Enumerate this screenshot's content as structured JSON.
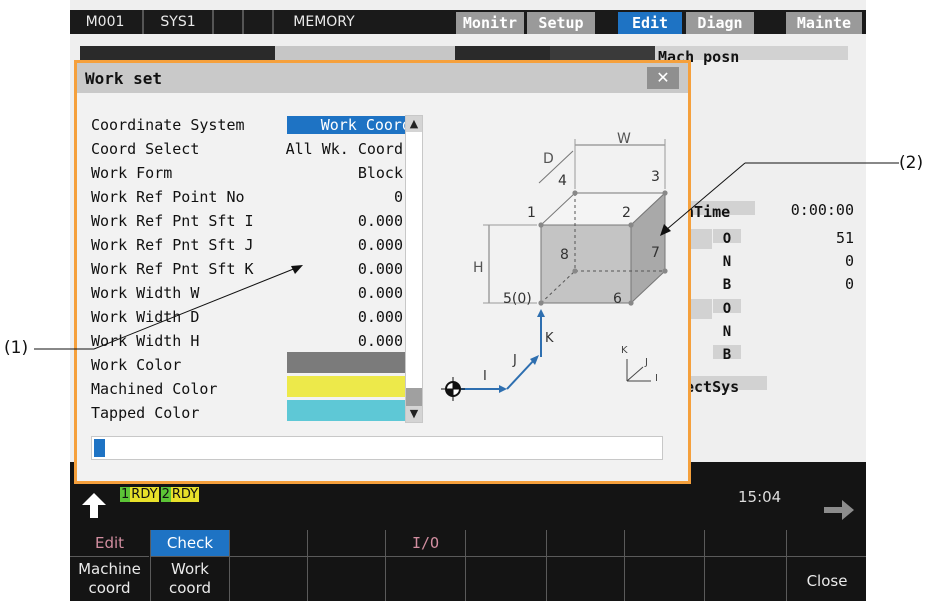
{
  "top_bar": {
    "machine": "M001",
    "system": "SYS1",
    "mode": "MEMORY",
    "menu_tabs": [
      "Monitr",
      "Setup",
      "Edit",
      "Diagn",
      "Mainte"
    ],
    "active_tab": "Edit"
  },
  "background_panel": {
    "mach_posn_label": "Mach posn",
    "time_label": "hTime",
    "time_value": "0:00:00",
    "rows_a": [
      {
        "key": "O",
        "value": "51"
      },
      {
        "key": "N",
        "value": "0"
      },
      {
        "key": "B",
        "value": "0"
      }
    ],
    "rows_b": [
      {
        "key": "O"
      },
      {
        "key": "N"
      },
      {
        "key": "B"
      }
    ],
    "select_label": "ectSys"
  },
  "dialog": {
    "title": "Work set",
    "close_glyph": "✕",
    "params": [
      {
        "label": "Coordinate System",
        "value": "Work Coord",
        "highlight": true
      },
      {
        "label": "Coord Select",
        "value": "All Wk. Coord"
      },
      {
        "label": "Work Form",
        "value": "Block"
      },
      {
        "label": "Work Ref Point No",
        "value": "0"
      },
      {
        "label": "Work Ref Pnt Sft I",
        "value": "0.000"
      },
      {
        "label": "Work Ref Pnt Sft J",
        "value": "0.000"
      },
      {
        "label": "Work Ref Pnt Sft K",
        "value": "0.000"
      },
      {
        "label": "Work Width W",
        "value": "0.000"
      },
      {
        "label": "Work Width D",
        "value": "0.000"
      },
      {
        "label": "Work Width H",
        "value": "0.000"
      },
      {
        "label": "Work Color",
        "swatch": "#7b7b7b"
      },
      {
        "label": "Machined Color",
        "swatch": "#ede94a"
      },
      {
        "label": "Tapped Color",
        "swatch": "#5ec8d6"
      }
    ],
    "scroll_up_glyph": "▲",
    "scroll_down_glyph": "▼",
    "progress_fraction": 0.02,
    "diagram": {
      "dim_W": "W",
      "dim_D": "D",
      "dim_H": "H",
      "vertices": [
        "1",
        "2",
        "3",
        "4",
        "5(0)",
        "6",
        "7",
        "8"
      ],
      "axis_I": "I",
      "axis_J": "J",
      "axis_K": "K",
      "mini_K": "K",
      "mini_J": "J",
      "mini_I": "I"
    }
  },
  "status": {
    "ready1_num": "1",
    "ready1_text": "RDY",
    "ready2_num": "2",
    "ready2_text": "RDY",
    "clock": "15:04"
  },
  "softkeys": [
    {
      "top": "Edit",
      "bottom": ""
    },
    {
      "top": "Check",
      "bottom": "Machine coord"
    },
    {
      "top": "",
      "bottom": "Work coord",
      "active": true
    },
    {
      "top": "",
      "bottom": ""
    },
    {
      "top": "I/O",
      "bottom": ""
    },
    {
      "top": "",
      "bottom": ""
    },
    {
      "top": "",
      "bottom": ""
    },
    {
      "top": "",
      "bottom": ""
    },
    {
      "top": "",
      "bottom": "Close"
    }
  ],
  "softkey_labels": {
    "edit": "Edit",
    "check": "Check",
    "io": "I/O",
    "machine_line1": "Machine",
    "machine_line2": "coord",
    "work_line1": "Work",
    "work_line2": "coord",
    "close": "Close"
  },
  "annotations": {
    "callout_1": "(1)",
    "callout_2": "(2)"
  },
  "colors": {
    "accent_blue": "#1e73c4",
    "dialog_border": "#f5a03c",
    "ready_green": "#5cc436",
    "softkey_red": "#d28ea0"
  }
}
